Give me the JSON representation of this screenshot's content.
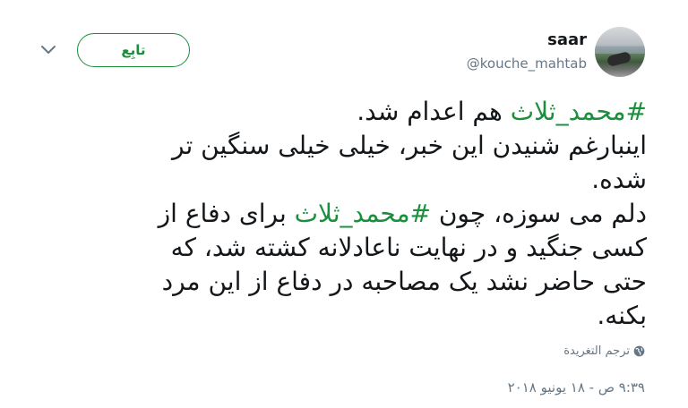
{
  "user": {
    "name": "saar",
    "handle": "@kouche_mahtab"
  },
  "follow_label": "تابِع",
  "tweet": {
    "line1_hashtag": "#محمد_ثلاث",
    "line1_rest": " هم اعدام شد.",
    "line2": "اینبارغم شنیدن این خبر، خیلی خیلی سنگین تر",
    "line3": "شده.",
    "line4_a": " دلم می سوزه، چون ",
    "line4_hashtag": "#محمد_ثلاث",
    "line4_b": "  برای دفاع از",
    "line5": "کسی جنگید و در نهایت ناعادلانه کشته شد، که",
    "line6": "حتی حاضر نشد یک مصاحبه در دفاع از این مرد",
    "line7": "بکنه."
  },
  "translate_label": "ترجم التغريدة",
  "timestamp": "۹:۳۹ ص - ۱۸ یونیو ۲۰۱۸",
  "colors": {
    "accent_green": "#1a8f3c",
    "secondary_text": "#657786"
  },
  "icons": {
    "menu": "chevron-down-icon",
    "translate": "globe-icon"
  }
}
